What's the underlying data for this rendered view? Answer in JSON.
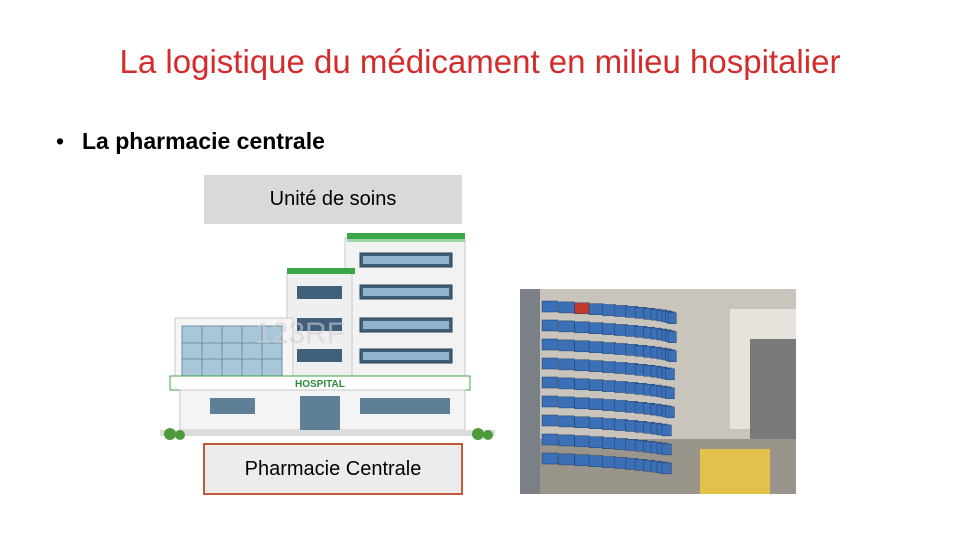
{
  "slide": {
    "title": "La logistique du médicament en milieu hospitalier",
    "bullet": {
      "symbol": "•",
      "text": "La pharmacie centrale"
    },
    "box_top": {
      "label": "Unité de soins"
    },
    "box_bottom": {
      "label": "Pharmacie Centrale"
    },
    "hospital_image": {
      "sign": "HOSPITAL",
      "watermark": "123RF"
    },
    "colors": {
      "title": "#d42b2b",
      "box_border": "#c55a3a",
      "box_fill": "#d9d9d9",
      "bin_blue": "#3b6fb6"
    }
  }
}
